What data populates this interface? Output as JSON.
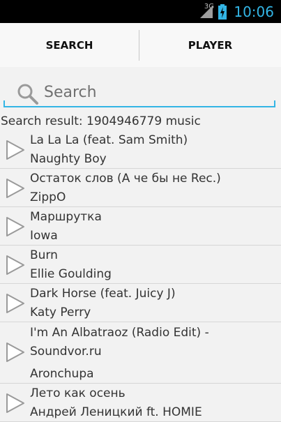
{
  "status_bar": {
    "network": "3G",
    "time": "10:06",
    "accent": "#33b5e5"
  },
  "tabs": [
    {
      "label": "SEARCH",
      "active": true
    },
    {
      "label": "PLAYER",
      "active": false
    }
  ],
  "search": {
    "placeholder": "Search",
    "value": ""
  },
  "result_text": "Search result: 1904946779 music",
  "results": [
    {
      "title": "La La La (feat. Sam Smith)",
      "artist": "Naughty Boy"
    },
    {
      "title": "Остаток слов  (А че бы не Rec.)",
      "artist": "ZippO"
    },
    {
      "title": "Маршрутка",
      "artist": "Iowa"
    },
    {
      "title": "Burn",
      "artist": "Ellie Goulding"
    },
    {
      "title": "Dark Horse (feat. Juicy J)",
      "artist": "Katy Perry"
    },
    {
      "title": "I'm An Albatraoz  (Radio Edit) - Soundvor.ru",
      "artist": "Aronchupa"
    },
    {
      "title": "Лето как осень",
      "artist": "Андрей Леницкий ft. HOMIE"
    }
  ]
}
